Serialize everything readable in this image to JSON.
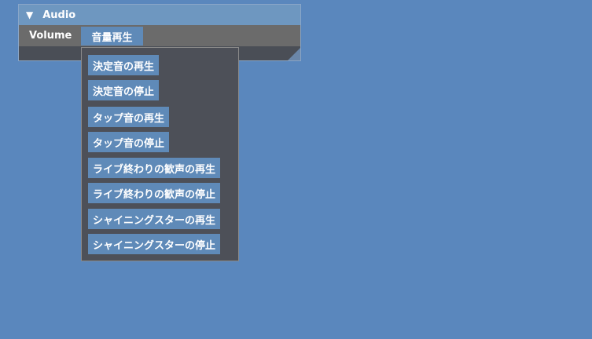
{
  "panel": {
    "title": "Audio",
    "collapse_icon": "triangle-down-icon",
    "volume_label": "Volume",
    "dropdown_value": "音量再生"
  },
  "dropdown": {
    "items": [
      "決定音の再生",
      "決定音の停止",
      "タップ音の再生",
      "タップ音の停止",
      "ライブ終わりの歓声の再生",
      "ライブ終わりの歓声の停止",
      "シャイニングスターの再生",
      "シャイニングスターの停止"
    ]
  }
}
